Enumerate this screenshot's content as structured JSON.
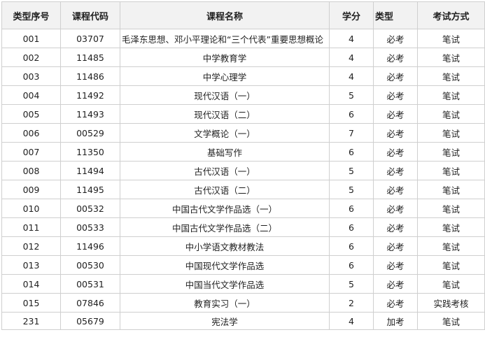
{
  "headers": {
    "seq": "类型序号",
    "code": "课程代码",
    "name": "课程名称",
    "credits": "学分",
    "type": "类型",
    "exam": "考试方式"
  },
  "rows": [
    {
      "seq": "001",
      "code": "03707",
      "name": "毛泽东思想、邓小平理论和“三个代表”重要思想概论",
      "credits": "4",
      "type": "必考",
      "exam": "笔试"
    },
    {
      "seq": "002",
      "code": "11485",
      "name": "中学教育学",
      "credits": "4",
      "type": "必考",
      "exam": "笔试"
    },
    {
      "seq": "003",
      "code": "11486",
      "name": "中学心理学",
      "credits": "4",
      "type": "必考",
      "exam": "笔试"
    },
    {
      "seq": "004",
      "code": "11492",
      "name": "现代汉语（一）",
      "credits": "5",
      "type": "必考",
      "exam": "笔试"
    },
    {
      "seq": "005",
      "code": "11493",
      "name": "现代汉语（二）",
      "credits": "6",
      "type": "必考",
      "exam": "笔试"
    },
    {
      "seq": "006",
      "code": "00529",
      "name": "文学概论（一）",
      "credits": "7",
      "type": "必考",
      "exam": "笔试"
    },
    {
      "seq": "007",
      "code": "11350",
      "name": "基础写作",
      "credits": "6",
      "type": "必考",
      "exam": "笔试"
    },
    {
      "seq": "008",
      "code": "11494",
      "name": "古代汉语（一）",
      "credits": "5",
      "type": "必考",
      "exam": "笔试"
    },
    {
      "seq": "009",
      "code": "11495",
      "name": "古代汉语（二）",
      "credits": "5",
      "type": "必考",
      "exam": "笔试"
    },
    {
      "seq": "010",
      "code": "00532",
      "name": "中国古代文学作品选（一）",
      "credits": "6",
      "type": "必考",
      "exam": "笔试"
    },
    {
      "seq": "011",
      "code": "00533",
      "name": "中国古代文学作品选（二）",
      "credits": "6",
      "type": "必考",
      "exam": "笔试"
    },
    {
      "seq": "012",
      "code": "11496",
      "name": "中小学语文教材教法",
      "credits": "6",
      "type": "必考",
      "exam": "笔试"
    },
    {
      "seq": "013",
      "code": "00530",
      "name": "中国现代文学作品选",
      "credits": "6",
      "type": "必考",
      "exam": "笔试"
    },
    {
      "seq": "014",
      "code": "00531",
      "name": "中国当代文学作品选",
      "credits": "5",
      "type": "必考",
      "exam": "笔试"
    },
    {
      "seq": "015",
      "code": "07846",
      "name": "教育实习（一）",
      "credits": "2",
      "type": "必考",
      "exam": "实践考核"
    },
    {
      "seq": "231",
      "code": "05679",
      "name": "宪法学",
      "credits": "4",
      "type": "加考",
      "exam": "笔试"
    }
  ]
}
